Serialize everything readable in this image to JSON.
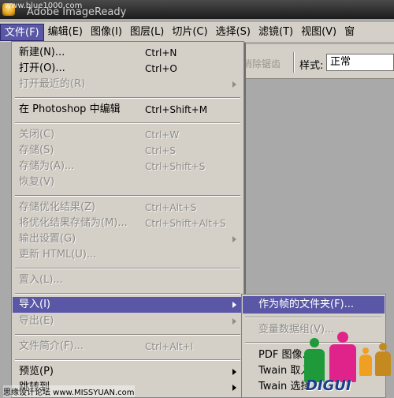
{
  "window": {
    "title": "Adobe ImageReady",
    "watermark_top": "www.blue1000.com"
  },
  "menubar": [
    {
      "label": "文件(F)",
      "active": true
    },
    {
      "label": "编辑(E)"
    },
    {
      "label": "图像(I)"
    },
    {
      "label": "图层(L)"
    },
    {
      "label": "切片(C)"
    },
    {
      "label": "选择(S)"
    },
    {
      "label": "滤镜(T)"
    },
    {
      "label": "视图(V)"
    },
    {
      "label": "窗"
    }
  ],
  "options_bar": {
    "antialias_label": "消除锯齿",
    "style_label": "样式:",
    "style_value": "正常"
  },
  "file_menu": {
    "new": {
      "label": "新建(N)...",
      "shortcut": "Ctrl+N"
    },
    "open": {
      "label": "打开(O)...",
      "shortcut": "Ctrl+O"
    },
    "open_recent": {
      "label": "打开最近的(R)"
    },
    "edit_in_photoshop": {
      "label": "在 Photoshop 中编辑",
      "shortcut": "Ctrl+Shift+M"
    },
    "close": {
      "label": "关闭(C)",
      "shortcut": "Ctrl+W"
    },
    "save": {
      "label": "存储(S)",
      "shortcut": "Ctrl+S"
    },
    "save_as": {
      "label": "存储为(A)...",
      "shortcut": "Ctrl+Shift+S"
    },
    "revert": {
      "label": "恢复(V)"
    },
    "save_optimized": {
      "label": "存储优化结果(Z)",
      "shortcut": "Ctrl+Alt+S"
    },
    "save_optimized_as": {
      "label": "将优化结果存储为(M)...",
      "shortcut": "Ctrl+Shift+Alt+S"
    },
    "output_settings": {
      "label": "输出设置(G)"
    },
    "update_html": {
      "label": "更新 HTML(U)..."
    },
    "place": {
      "label": "置入(L)..."
    },
    "import": {
      "label": "导入(I)"
    },
    "export": {
      "label": "导出(E)"
    },
    "file_info": {
      "label": "文件简介(F)...",
      "shortcut": "Ctrl+Alt+I"
    },
    "preview": {
      "label": "预览(P)"
    },
    "jump_to": {
      "label": "跳转到"
    }
  },
  "import_submenu": {
    "folder_as_frames": "作为帧的文件夹(F)...",
    "variable_data_sets": "变量数据组(V)...",
    "pdf_image": "PDF 图像...",
    "twain_acquire": "Twain 取入...",
    "twain_select": "Twain 选择..."
  },
  "watermark": {
    "bottom_left": "思缘设计论坛 www.MISSYUAN.com",
    "brand": "DIGUI"
  },
  "colors": {
    "menu_bg": "#d4d0c8",
    "highlight": "#5a58a6",
    "disabled_text": "#8e8b85"
  }
}
